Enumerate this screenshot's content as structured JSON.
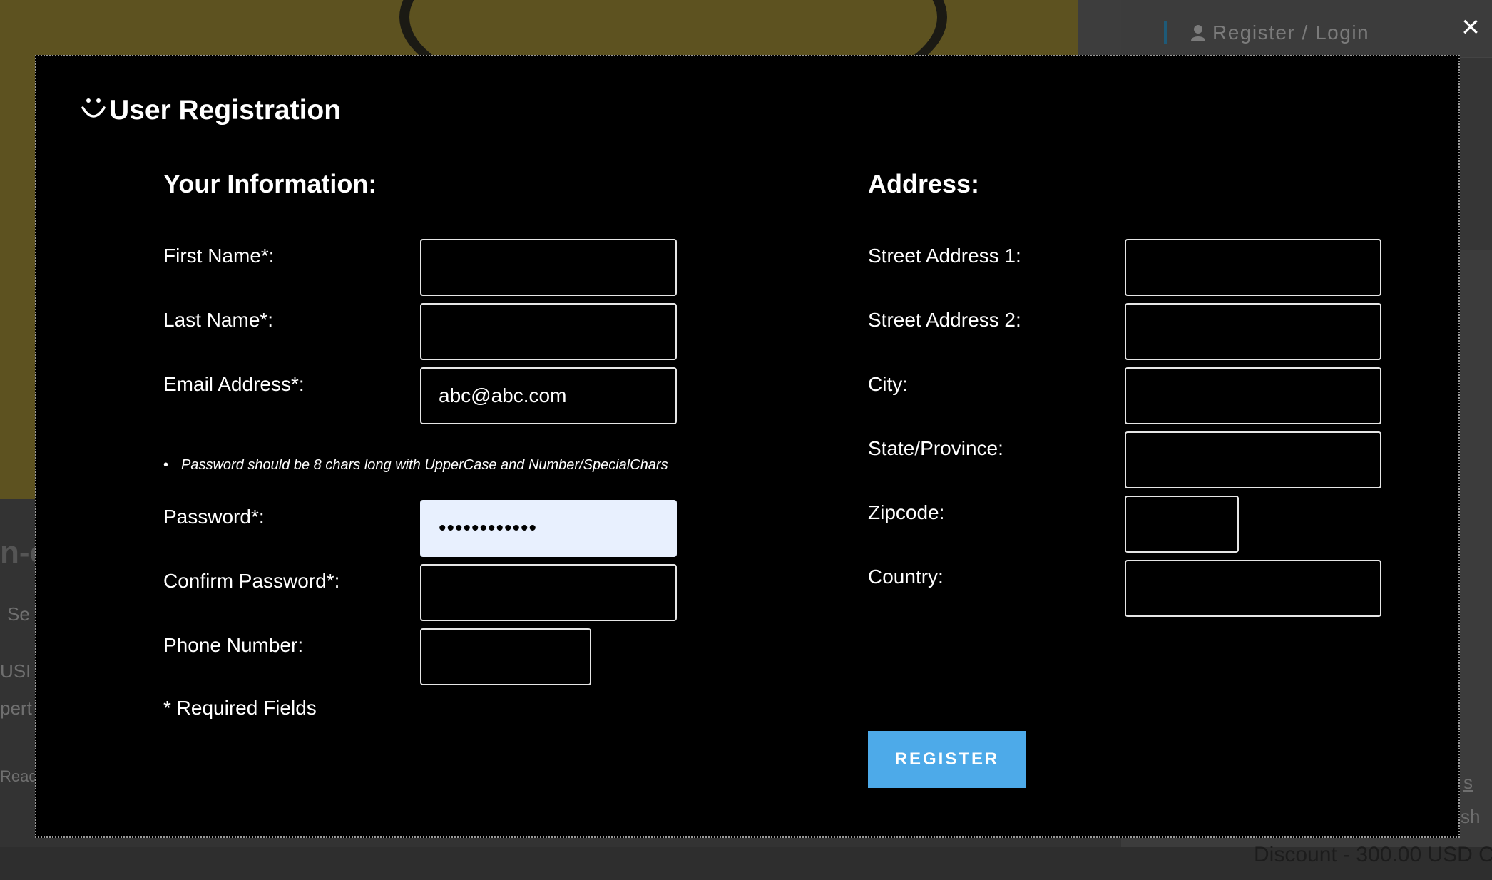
{
  "background": {
    "login_label": "Register / Login",
    "fragments": [
      "n-c",
      "Se",
      "USI",
      "pert",
      "Read",
      "s",
      "sh"
    ],
    "discount_text": "Discount - 300.00 USD C"
  },
  "modal": {
    "title": "User Registration",
    "close_symbol": "×",
    "info_section_title": "Your Information:",
    "address_section_title": "Address:",
    "fields": {
      "first_name_label": "First Name*:",
      "last_name_label": "Last Name*:",
      "email_label": "Email Address*:",
      "email_value": "abc@abc.com",
      "password_hint": "Password should be 8 chars long with UpperCase and Number/SpecialChars",
      "password_label": "Password*:",
      "password_value": "••••••••••••",
      "confirm_password_label": "Confirm Password*:",
      "phone_label": "Phone Number:",
      "street1_label": "Street Address 1:",
      "street2_label": "Street Address 2:",
      "city_label": "City:",
      "state_label": "State/Province:",
      "zipcode_label": "Zipcode:",
      "country_label": "Country:"
    },
    "required_note": "* Required Fields",
    "register_label": "REGISTER"
  },
  "icons": [
    "user-icon",
    "smiley-icon",
    "close-icon"
  ],
  "colors": {
    "modal_bg": "#000000",
    "button": "#4daae9",
    "autofill": "#e8f0fe"
  }
}
